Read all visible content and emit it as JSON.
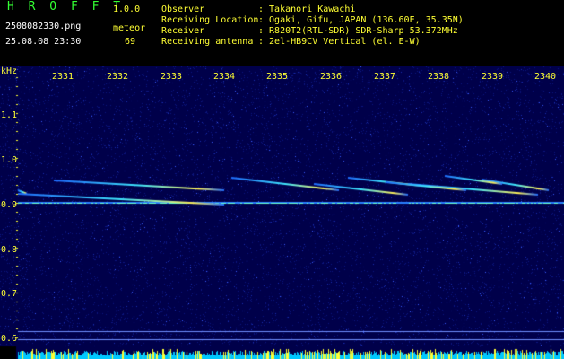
{
  "header": {
    "app_name": "H R O F F T",
    "version": "1.0.0",
    "filename": "2508082330.png",
    "datetime": "25.08.08 23:30",
    "count_label": "meteor",
    "count_value": "69",
    "info": [
      {
        "key": "Observer",
        "value": ": Takanori Kawachi"
      },
      {
        "key": "Receiving Location",
        "value": ": Ogaki, Gifu, JAPAN (136.60E, 35.35N)"
      },
      {
        "key": "Receiver",
        "value": ": R820T2(RTL-SDR) SDR-Sharp 53.372MHz"
      },
      {
        "key": "Receiving antenna",
        "value": ": 2el-HB9CV Vertical (el. E-W)"
      }
    ]
  },
  "axis": {
    "y_unit": "kHz",
    "x_ticks": [
      "2331",
      "2332",
      "2333",
      "2334",
      "2335",
      "2336",
      "2337",
      "2338",
      "2339",
      "2340"
    ],
    "y_ticks": [
      "1.1",
      "1.0",
      "0.9",
      "0.8",
      "0.7",
      "0.6"
    ]
  },
  "colors": {
    "background": "#00004a",
    "text_yellow": "#ffff33",
    "text_green": "#33ff33",
    "carrier": "#66ffcc",
    "noise_bar": "#00c8ff"
  }
}
